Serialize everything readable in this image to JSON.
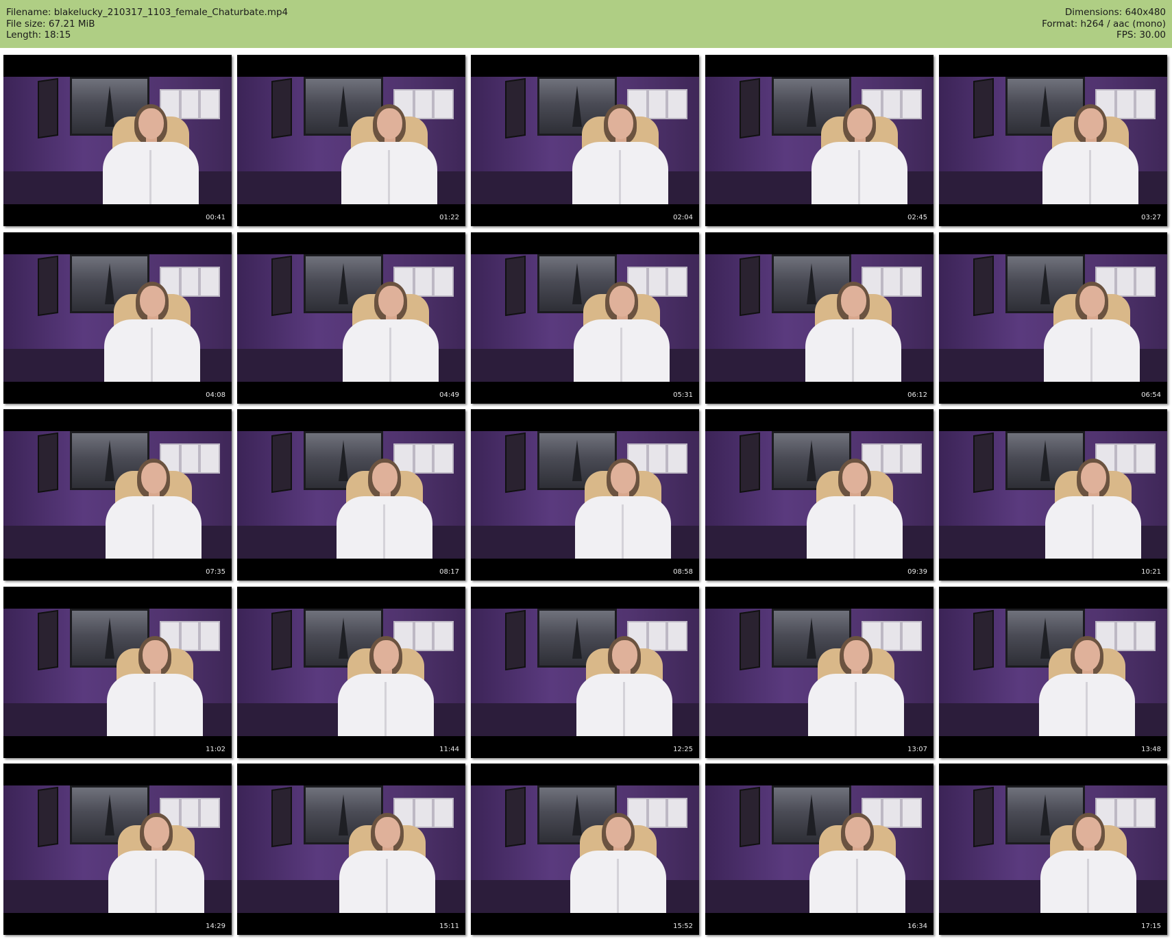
{
  "header": {
    "filename_line": "Filename: blakelucky_210317_1103_female_Chaturbate.mp4",
    "filesize_line": "File size: 67.21 MiB",
    "length_line": "Length: 18:15",
    "dimensions_line": "Dimensions: 640x480",
    "format_line": "Format: h264 / aac (mono)",
    "fps_line": "FPS: 30.00"
  },
  "colors": {
    "header_background": "#afce84",
    "page_background": "#ffffff",
    "letterbox": "#000000"
  },
  "thumbnails": [
    {
      "timestamp": "00:41"
    },
    {
      "timestamp": "01:22"
    },
    {
      "timestamp": "02:04"
    },
    {
      "timestamp": "02:45"
    },
    {
      "timestamp": "03:27"
    },
    {
      "timestamp": "04:08"
    },
    {
      "timestamp": "04:49"
    },
    {
      "timestamp": "05:31"
    },
    {
      "timestamp": "06:12"
    },
    {
      "timestamp": "06:54"
    },
    {
      "timestamp": "07:35"
    },
    {
      "timestamp": "08:17"
    },
    {
      "timestamp": "08:58"
    },
    {
      "timestamp": "09:39"
    },
    {
      "timestamp": "10:21"
    },
    {
      "timestamp": "11:02"
    },
    {
      "timestamp": "11:44"
    },
    {
      "timestamp": "12:25"
    },
    {
      "timestamp": "13:07"
    },
    {
      "timestamp": "13:48"
    },
    {
      "timestamp": "14:29"
    },
    {
      "timestamp": "15:11"
    },
    {
      "timestamp": "15:52"
    },
    {
      "timestamp": "16:34"
    },
    {
      "timestamp": "17:15"
    }
  ]
}
